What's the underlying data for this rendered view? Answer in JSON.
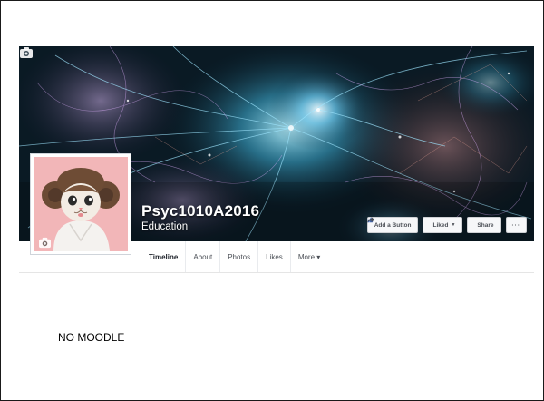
{
  "page": {
    "name": "Psyc1010A2016",
    "category": "Education"
  },
  "actions": {
    "add_button": "Add a Button",
    "liked": "Liked",
    "liked_caret": "▼",
    "share": "Share",
    "more": "···"
  },
  "tabs": [
    {
      "label": "Timeline",
      "active": true
    },
    {
      "label": "About",
      "active": false
    },
    {
      "label": "Photos",
      "active": false
    },
    {
      "label": "Likes",
      "active": false
    },
    {
      "label": "More ▾",
      "active": false
    }
  ],
  "note": "NO MOODLE",
  "icons": {
    "cover_camera": "camera-icon",
    "profile_camera": "camera-icon",
    "liked": "thumbs-up-icon",
    "share": "share-arrow-icon"
  },
  "colors": {
    "facebook_blue": "#4267b2",
    "button_bg": "#f6f7f9",
    "button_border": "#ced0d4",
    "profile_bg": "#f2b6b8"
  }
}
